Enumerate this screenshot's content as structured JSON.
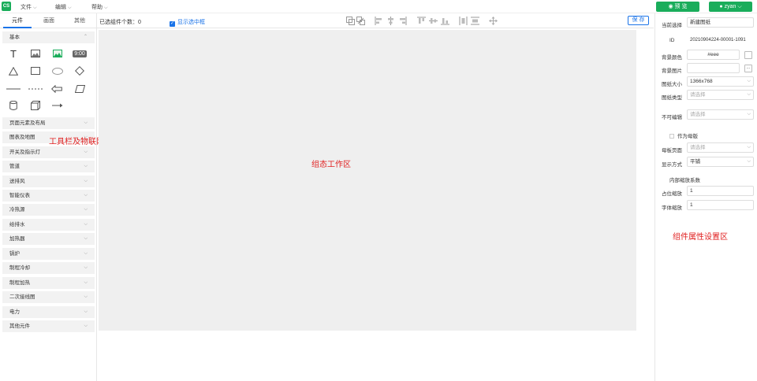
{
  "app": {
    "logo": "CS",
    "menus": [
      {
        "label": "文件"
      },
      {
        "label": "编辑"
      },
      {
        "label": "帮助"
      }
    ],
    "preview_label": "预 览",
    "user_label": "zyan"
  },
  "left_panel": {
    "tabs": [
      "元件",
      "画面",
      "其他"
    ],
    "active_tab": 0,
    "basic_category": "基本",
    "clock_text": "9:00",
    "categories": [
      "页面元素及布局",
      "图表及地图",
      "开关及指示灯",
      "管道",
      "送排风",
      "智能仪表",
      "冷热源",
      "给排水",
      "加热器",
      "锅炉",
      "制程冷却",
      "制程加热",
      "二次接线图",
      "电力",
      "其他元件"
    ],
    "annotation": "工具栏及物联网组件"
  },
  "toolbar": {
    "selected_count_label": "已选组件个数：",
    "selected_count": "0",
    "show_border_label": "显示选中框",
    "save_label": "保 存"
  },
  "canvas": {
    "annotation": "组态工作区"
  },
  "right_panel": {
    "current_select_label": "当前选择",
    "current_select_value": "新建图纸",
    "id_label": "ID",
    "id_value": "20210904224-00001-1091",
    "bg_color_label": "背景颜色",
    "bg_color_value": "#eee",
    "bg_image_label": "背景图片",
    "bg_image_btn": "...",
    "size_label": "图纸大小",
    "size_value": "1366x768",
    "type_label": "图纸类型",
    "type_placeholder": "请选择",
    "not_editable_label": "不可编辑",
    "not_editable_placeholder": "请选择",
    "master_checkbox_label": "作为母版",
    "master_page_label": "母板页面",
    "master_page_placeholder": "请选择",
    "display_mode_label": "显示方式",
    "display_mode_value": "平铺",
    "inner_scale_label": "内部缩放系数",
    "placeholder_scale_label": "占位缩放",
    "placeholder_scale_value": "1",
    "font_scale_label": "字体缩放",
    "font_scale_value": "1",
    "annotation": "组件属性设置区"
  },
  "colors": {
    "brand_green": "#1aad5b",
    "accent_blue": "#1a73e8",
    "annotation_red": "#e02020",
    "canvas_bg": "#efefef"
  }
}
